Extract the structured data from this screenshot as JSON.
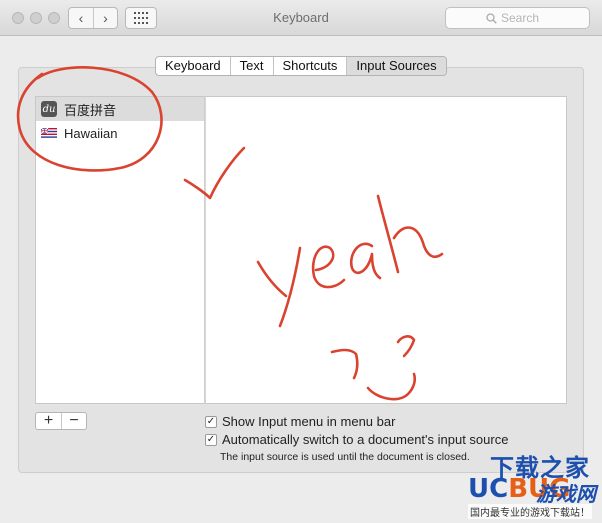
{
  "window": {
    "title": "Keyboard"
  },
  "toolbar": {
    "back_glyph": "‹",
    "forward_glyph": "›",
    "search_placeholder": "Search"
  },
  "tabs": [
    {
      "label": "Keyboard"
    },
    {
      "label": "Text"
    },
    {
      "label": "Shortcuts"
    },
    {
      "label": "Input Sources",
      "selected": true
    }
  ],
  "sources": {
    "items": [
      {
        "label": "百度拼音",
        "icon": "du-icon",
        "icon_text": "du",
        "selected": true
      },
      {
        "label": "Hawaiian",
        "icon": "hawaii-flag-icon",
        "selected": false
      }
    ],
    "add_glyph": "+",
    "remove_glyph": "−"
  },
  "options": {
    "show_menu": {
      "label": "Show Input menu in menu bar",
      "checked": true
    },
    "auto_switch": {
      "label": "Automatically switch to a document's input source",
      "checked": true
    },
    "check_glyph": "✓",
    "note": "The input source is used until the document is closed."
  },
  "annotations": {
    "color": "#d9432f",
    "text": "yeah"
  },
  "watermark": {
    "top": "下载之家",
    "brand_uc": "UC",
    "brand_bug": "BUG",
    "brand_game": "游戏网",
    "bottom": "国内最专业的游戏下载站！"
  }
}
